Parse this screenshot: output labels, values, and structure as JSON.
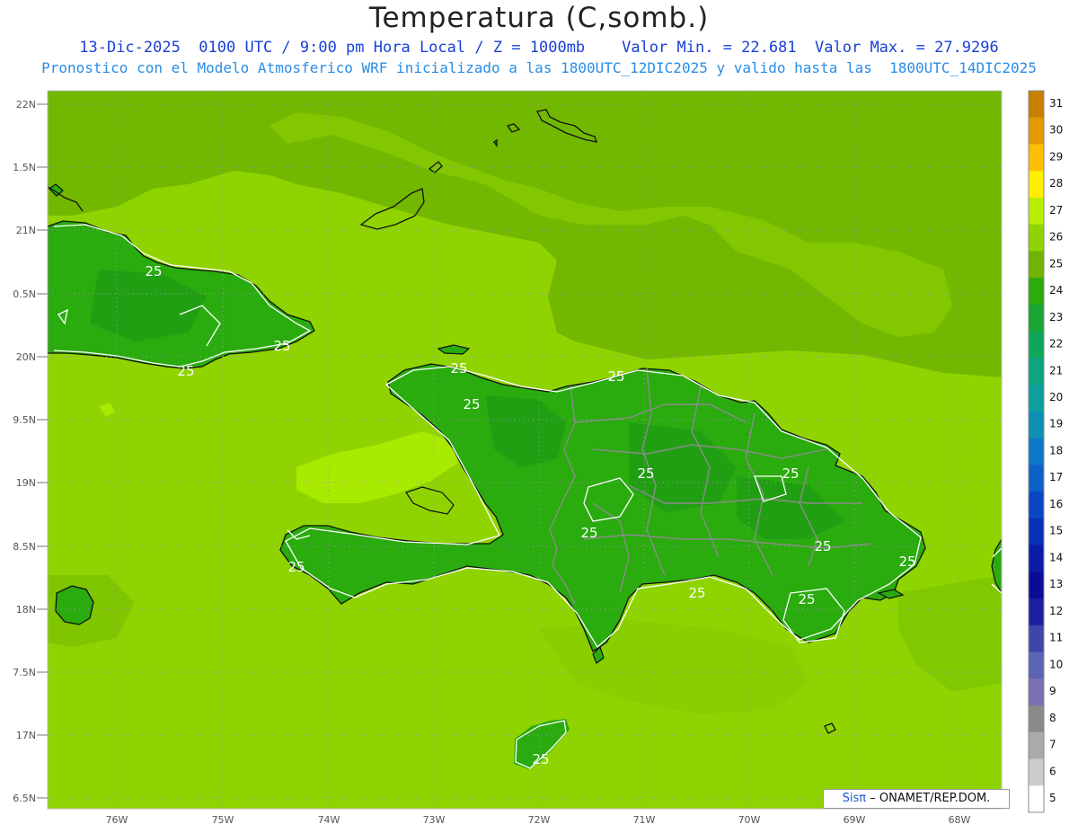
{
  "header": {
    "title": "Temperatura (C,somb.)",
    "line1": "13-Dic-2025  0100 UTC / 9:00 pm Hora Local / Z = 1000mb    Valor Min. = 22.681  Valor Max. = 27.9296",
    "line2": "Pronostico con el Modelo Atmosferico WRF inicializado a las 1800UTC_12DIC2025 y valido hasta las  1800UTC_14DIC2025"
  },
  "map": {
    "lat_labels": [
      "22N",
      "1.5N",
      "21N",
      "0.5N",
      "20N",
      "9.5N",
      "19N",
      "8.5N",
      "18N",
      "7.5N",
      "17N",
      "6.5N"
    ],
    "lon_labels": [
      "76W",
      "75W",
      "74W",
      "73W",
      "72W",
      "71W",
      "70W",
      "69W",
      "68W"
    ],
    "contour_labels": [
      "25",
      "25",
      "25",
      "25",
      "25",
      "25",
      "25",
      "25",
      "25",
      "25",
      "25",
      "25",
      "25",
      "25",
      "25"
    ],
    "colors": {
      "sea": "#8fd400",
      "warm_sea": "#a8ea00",
      "cool_sea": "#72b800",
      "land": "#2aab0e",
      "land_dark": "#1d9a14",
      "coast": "#111111",
      "border": "#8c8c8c",
      "contour": "#ffffff"
    }
  },
  "legend": {
    "labels": [
      "31",
      "30",
      "29",
      "28",
      "27",
      "26",
      "25",
      "24",
      "23",
      "22",
      "21",
      "20",
      "19",
      "18",
      "17",
      "16",
      "15",
      "14",
      "13",
      "12",
      "11",
      "10",
      "9",
      "8",
      "7",
      "6",
      "5"
    ],
    "colors": [
      "#c88000",
      "#e29a00",
      "#ffbf00",
      "#ffee00",
      "#b8ee00",
      "#8fd400",
      "#6eb400",
      "#2aab0e",
      "#19a632",
      "#0fa65a",
      "#0ea47e",
      "#0c9f9e",
      "#0d8fb4",
      "#0d79c6",
      "#0c60c8",
      "#0b46c2",
      "#0a2fb8",
      "#0a1ca6",
      "#0b0c96",
      "#1b1f9e",
      "#3f45aa",
      "#5a63b4",
      "#7b71b0",
      "#8a8a8a",
      "#aaaaaa",
      "#cccccc",
      "#ffffff"
    ]
  },
  "credit": {
    "sis": "Sisπ",
    "rest": "– ONAMET/REP.DOM."
  }
}
